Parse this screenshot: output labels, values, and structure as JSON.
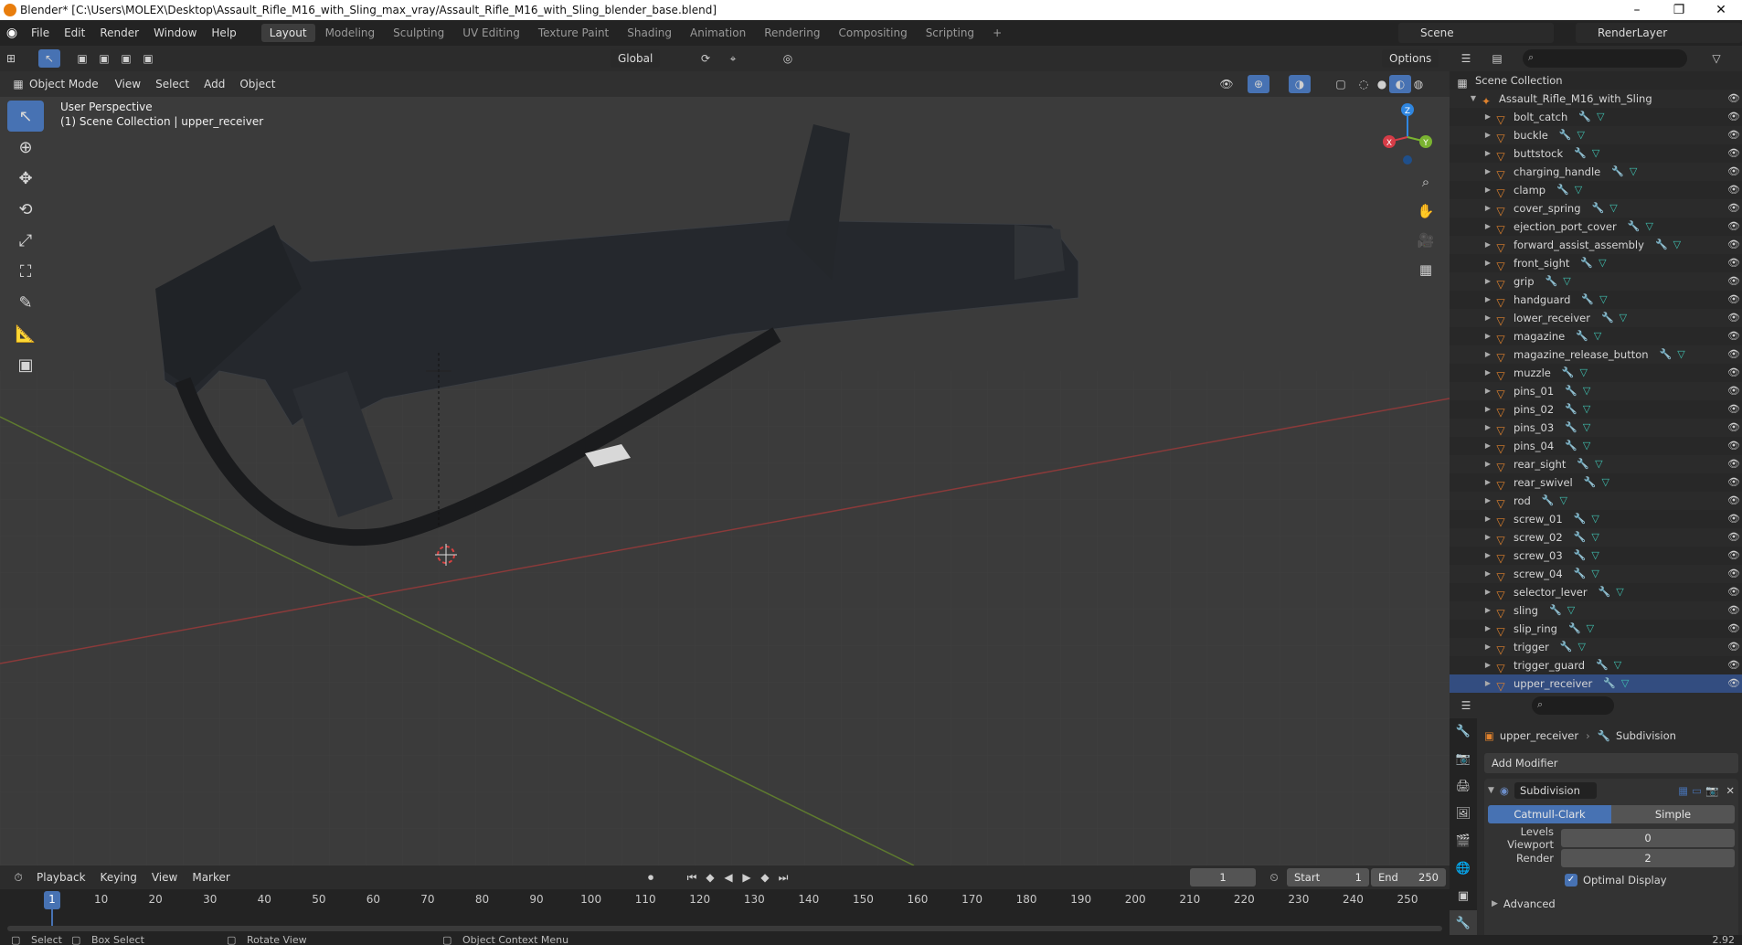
{
  "window": {
    "title": "Blender* [C:\\Users\\MOLEX\\Desktop\\Assault_Rifle_M16_with_Sling_max_vray/Assault_Rifle_M16_with_Sling_blender_base.blend]",
    "minimize": "–",
    "maximize": "❐",
    "close": "✕"
  },
  "menu": [
    "File",
    "Edit",
    "Render",
    "Window",
    "Help"
  ],
  "workspaces": [
    "Layout",
    "Modeling",
    "Sculpting",
    "UV Editing",
    "Texture Paint",
    "Shading",
    "Animation",
    "Rendering",
    "Compositing",
    "Scripting"
  ],
  "workspace_add": "+",
  "active_workspace": "Layout",
  "scene": {
    "name": "Scene",
    "render_layer": "RenderLayer"
  },
  "viewport_header": {
    "transform_orientation": "Global",
    "options": "Options",
    "mode": "Object Mode",
    "menus": [
      "View",
      "Select",
      "Add",
      "Object"
    ]
  },
  "viewport": {
    "perspective": "User Perspective",
    "collection_info": "(1) Scene Collection | upper_receiver",
    "gizmo_axes": {
      "x": "X",
      "y": "Y",
      "z": "Z"
    }
  },
  "outliner": {
    "root": "Scene Collection",
    "collection": "Assault_Rifle_M16_with_Sling",
    "objects": [
      "bolt_catch",
      "buckle",
      "buttstock",
      "charging_handle",
      "clamp",
      "cover_spring",
      "ejection_port_cover",
      "forward_assist_assembly",
      "front_sight",
      "grip",
      "handguard",
      "lower_receiver",
      "magazine",
      "magazine_release_button",
      "muzzle",
      "pins_01",
      "pins_02",
      "pins_03",
      "pins_04",
      "rear_sight",
      "rear_swivel",
      "rod",
      "screw_01",
      "screw_02",
      "screw_03",
      "screw_04",
      "selector_lever",
      "sling",
      "slip_ring",
      "trigger",
      "trigger_guard",
      "upper_receiver"
    ],
    "selected": "upper_receiver"
  },
  "properties": {
    "object_name": "upper_receiver",
    "modifier_name_breadcrumb": "Subdivision",
    "add_modifier": "Add Modifier",
    "modifier": {
      "name": "Subdivision",
      "mode_a": "Catmull-Clark",
      "mode_b": "Simple",
      "levels_viewport_label": "Levels Viewport",
      "levels_viewport": "0",
      "render_label": "Render",
      "render": "2",
      "optimal_display": "Optimal Display",
      "advanced": "Advanced"
    }
  },
  "timeline": {
    "menus": [
      "Playback",
      "Keying",
      "View",
      "Marker"
    ],
    "current_frame": "1",
    "start_label": "Start",
    "start": "1",
    "end_label": "End",
    "end": "250",
    "ruler": [
      "1",
      "10",
      "20",
      "30",
      "40",
      "50",
      "60",
      "70",
      "80",
      "90",
      "100",
      "110",
      "120",
      "130",
      "140",
      "150",
      "160",
      "170",
      "180",
      "190",
      "200",
      "210",
      "220",
      "230",
      "240",
      "250"
    ]
  },
  "status_bar": {
    "select": "Select",
    "box_select": "Box Select",
    "rotate": "Rotate View",
    "context_menu": "Object Context Menu",
    "version": "2.92"
  },
  "colors": {
    "accent": "#4772b3",
    "object_icon": "#e0822d",
    "mesh_icon": "#3fc0b0",
    "axis_x": "#d63c47",
    "axis_y": "#7ab331",
    "axis_z": "#2f86e0"
  }
}
